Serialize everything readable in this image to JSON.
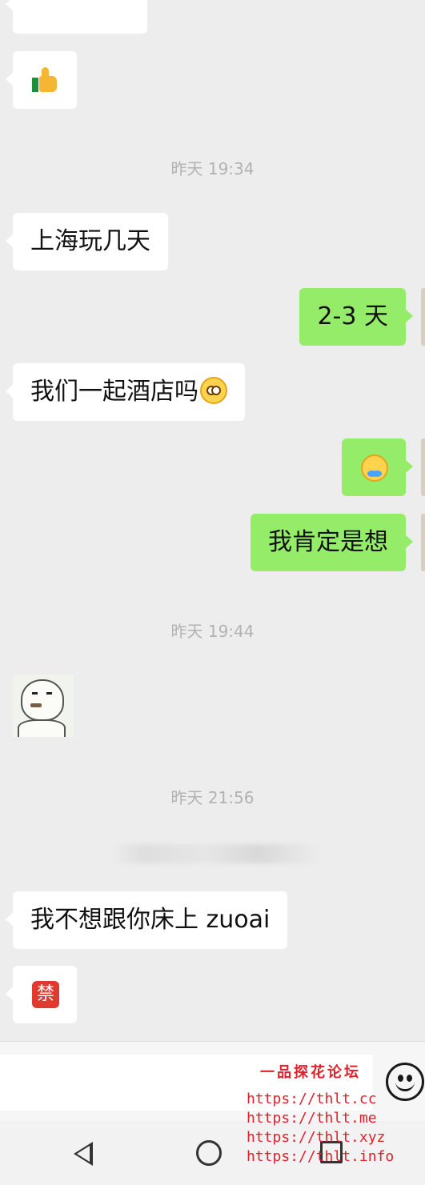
{
  "chat": {
    "messages": [
      {
        "side": "left",
        "type": "emoji",
        "emoji": "thumbs-up"
      },
      {
        "type": "timestamp",
        "text": "昨天 19:34"
      },
      {
        "side": "left",
        "type": "text",
        "text": "上海玩几天"
      },
      {
        "side": "right",
        "type": "text",
        "text": "2-3 天"
      },
      {
        "side": "left",
        "type": "text",
        "text": "我们一起酒店吗",
        "emoji": "flushed-face"
      },
      {
        "side": "right",
        "type": "emoji",
        "emoji": "laughing-crying-face"
      },
      {
        "side": "right",
        "type": "text",
        "text": "我肯定是想"
      },
      {
        "type": "timestamp",
        "text": "昨天 19:44"
      },
      {
        "side": "left",
        "type": "sticker",
        "sticker": "bear-meme-face"
      },
      {
        "type": "timestamp",
        "text": "昨天 21:56"
      },
      {
        "side": "left",
        "type": "text",
        "text": "我不想跟你床上 zuoai"
      },
      {
        "side": "left",
        "type": "emoji",
        "emoji": "forbidden-sign",
        "text": "禁"
      }
    ]
  },
  "input_bar": {
    "emoji_button_icon": "smiley-icon"
  },
  "watermark": {
    "title": "一品探花论坛",
    "urls": [
      "https://thlt.cc",
      "https://thlt.me",
      "https://thlt.xyz",
      "https://thlt.info"
    ]
  },
  "navbar": {
    "icons": [
      "back-icon",
      "home-icon",
      "recent-apps-icon"
    ]
  },
  "colors": {
    "background": "#ededed",
    "incoming_bubble": "#ffffff",
    "outgoing_bubble": "#95ec69",
    "timestamp_text": "#b2b2b2",
    "watermark": "#e0202a"
  }
}
